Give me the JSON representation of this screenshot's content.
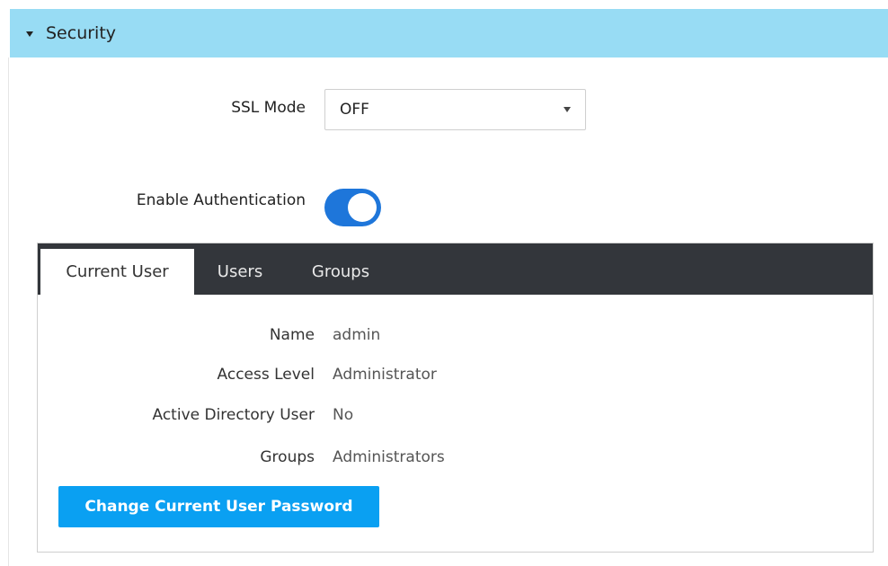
{
  "section": {
    "title": "Security",
    "header_color": "#98dcf4"
  },
  "ssl": {
    "label": "SSL Mode",
    "value": "OFF"
  },
  "authentication": {
    "label": "Enable Authentication",
    "enabled": true,
    "toggle_color": "#1e76da"
  },
  "tabs": [
    {
      "label": "Current User",
      "active": true
    },
    {
      "label": "Users",
      "active": false
    },
    {
      "label": "Groups",
      "active": false
    }
  ],
  "current_user": {
    "rows": [
      {
        "label": "Name",
        "value": "admin"
      },
      {
        "label": "Access Level",
        "value": "Administrator"
      },
      {
        "label": "Active Directory User",
        "value": "No"
      },
      {
        "label": "Groups",
        "value": "Administrators"
      }
    ],
    "change_password_label": "Change Current User Password",
    "button_color": "#0aa0f2"
  }
}
